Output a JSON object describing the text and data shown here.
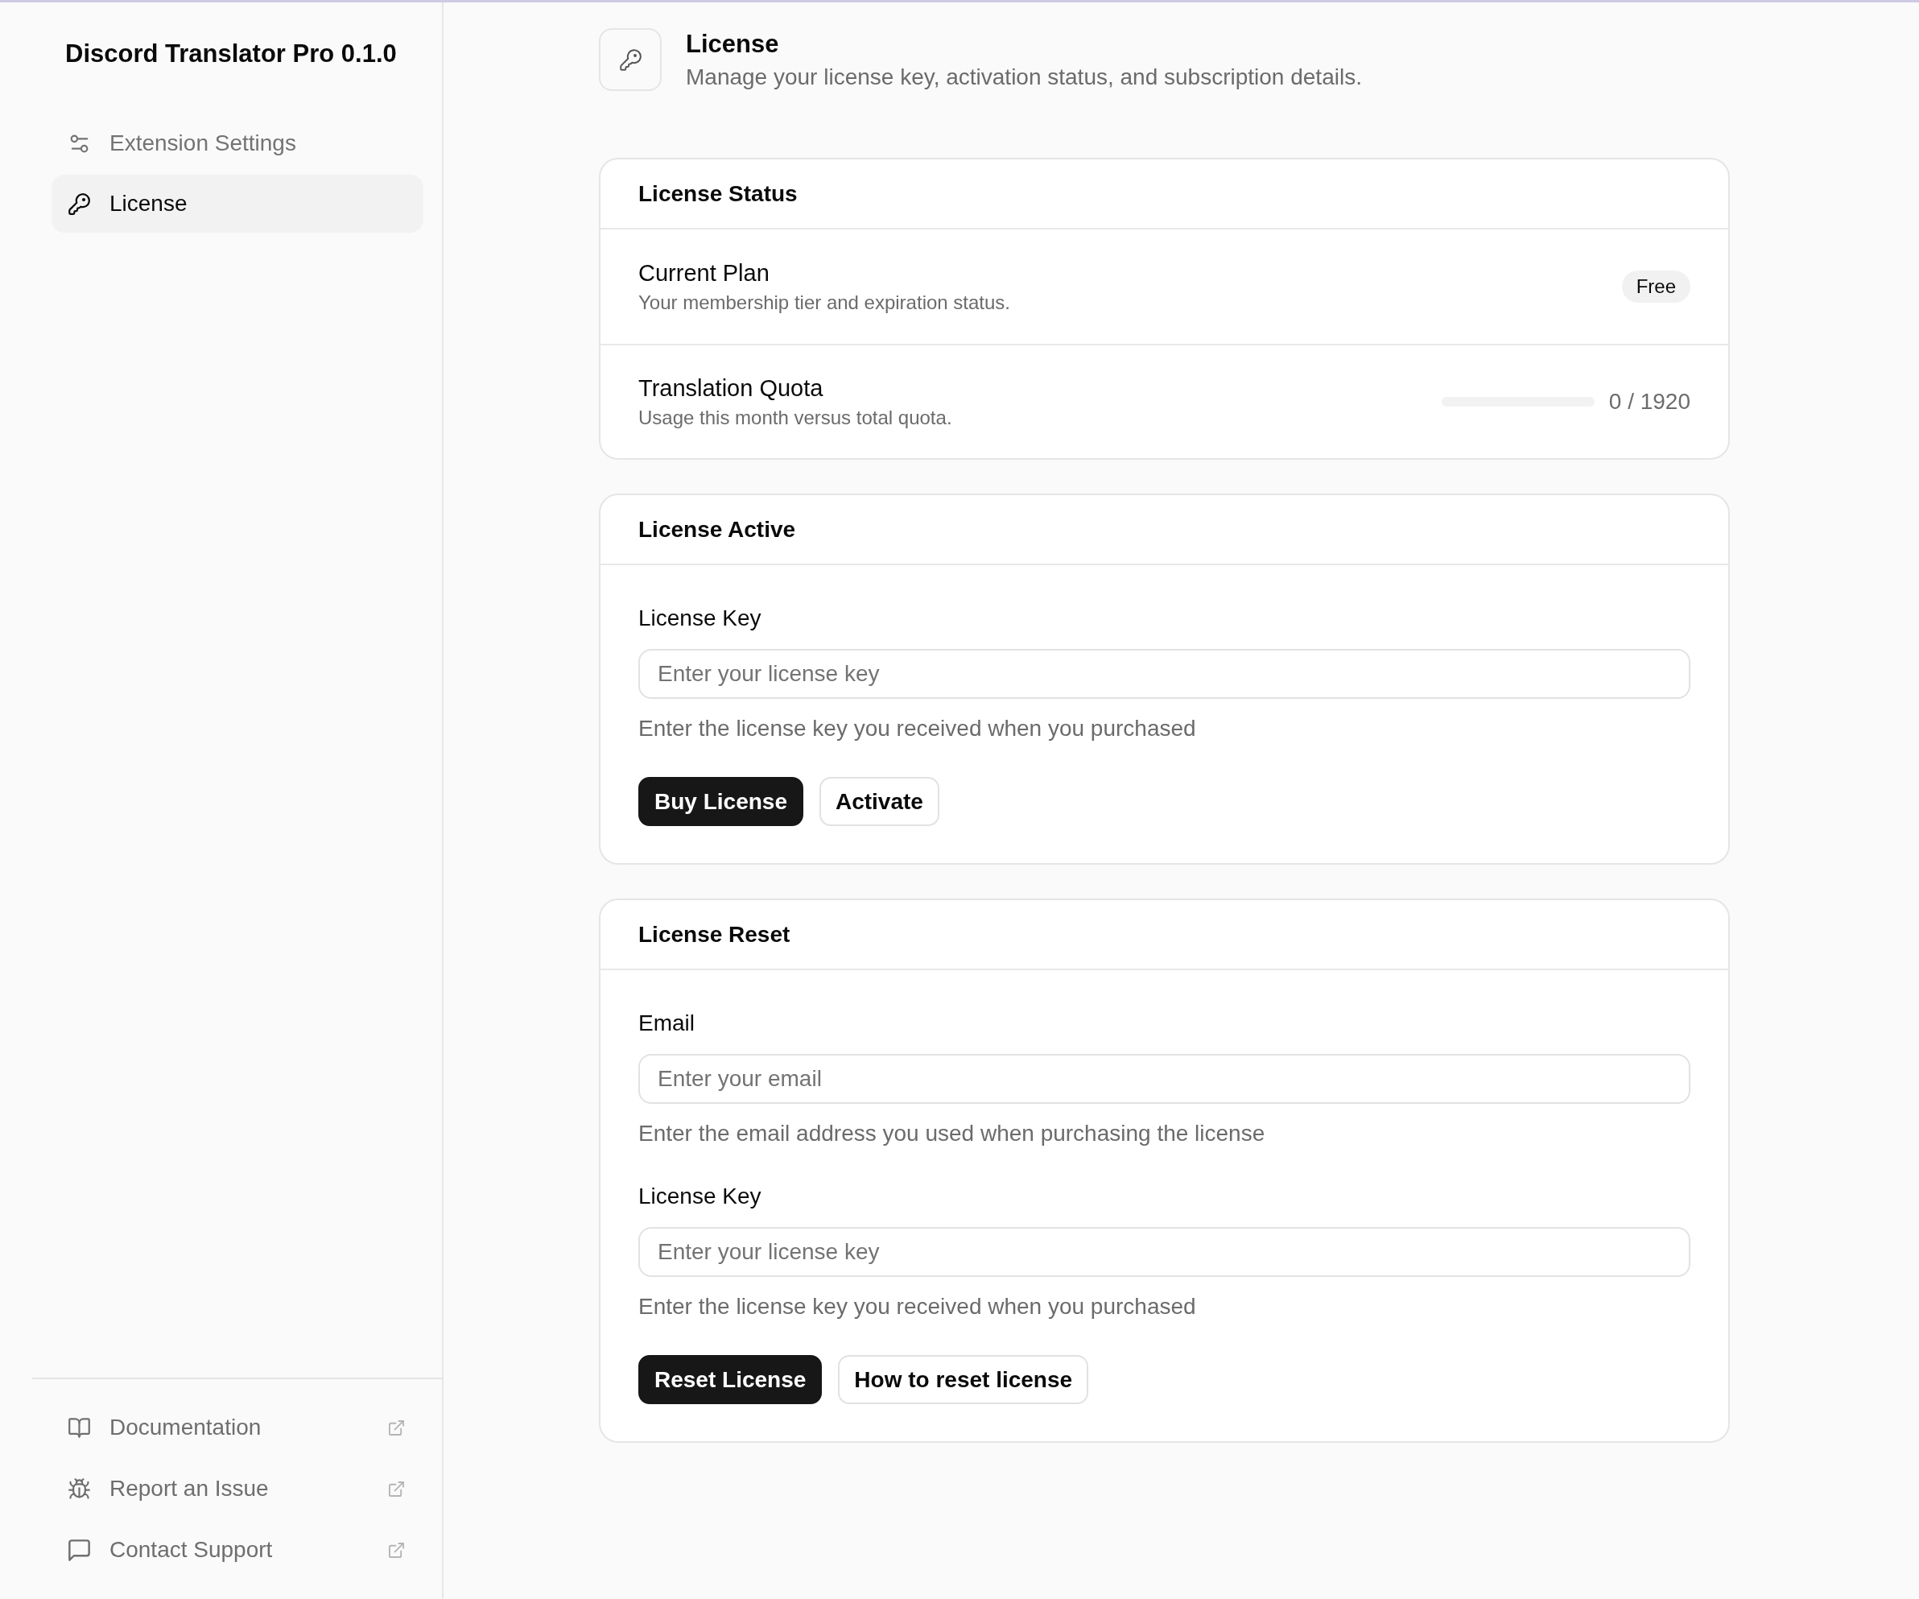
{
  "sidebar": {
    "title": "Discord Translator Pro 0.1.0",
    "items": [
      {
        "label": "Extension Settings",
        "selected": false
      },
      {
        "label": "License",
        "selected": true
      }
    ],
    "links": [
      {
        "label": "Documentation"
      },
      {
        "label": "Report an Issue"
      },
      {
        "label": "Contact Support"
      }
    ]
  },
  "header": {
    "title": "License",
    "subtitle": "Manage your license key, activation status, and subscription details."
  },
  "cards": [
    {
      "kind": "status",
      "title": "License Status",
      "rows": [
        {
          "kind": "badge",
          "title": "Current Plan",
          "description": "Your membership tier and expiration status.",
          "badge": "Free"
        },
        {
          "kind": "meter",
          "title": "Translation Quota",
          "description": "Usage this month versus total quota.",
          "level": 0,
          "reading": "0 / 1920"
        }
      ]
    },
    {
      "kind": "form",
      "title": "License Active",
      "fields": [
        {
          "label": "License Key",
          "placeholder": "Enter your license key",
          "hint": "Enter the license key you received when you purchased"
        }
      ],
      "buttons": [
        {
          "label": "Buy License",
          "kind": "primary"
        },
        {
          "label": "Activate",
          "kind": "secondary"
        }
      ]
    },
    {
      "kind": "form",
      "title": "License Reset",
      "fields": [
        {
          "label": "Email",
          "placeholder": "Enter your email",
          "hint": "Enter the email address you used when purchasing the license"
        },
        {
          "label": "License Key",
          "placeholder": "Enter your license key",
          "hint": "Enter the license key you received when you purchased"
        }
      ],
      "buttons": [
        {
          "label": "Reset License",
          "kind": "primary"
        },
        {
          "label": "How to reset license",
          "kind": "secondary"
        }
      ]
    }
  ]
}
